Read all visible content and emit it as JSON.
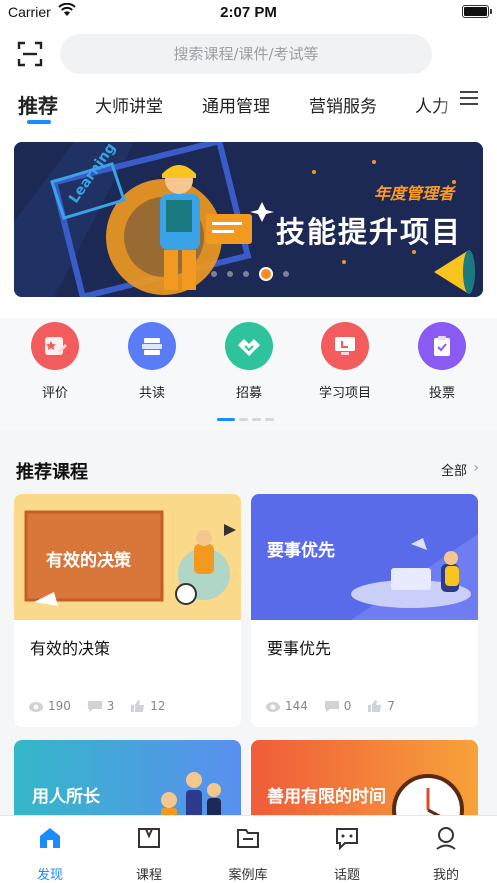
{
  "status": {
    "carrier": "Carrier",
    "time": "2:07 PM"
  },
  "search": {
    "placeholder": "搜索课程/课件/考试等"
  },
  "tabs": [
    {
      "label": "推荐"
    },
    {
      "label": "大师讲堂"
    },
    {
      "label": "通用管理"
    },
    {
      "label": "营销服务"
    },
    {
      "label": "人力"
    }
  ],
  "banner": {
    "title": "技能提升项目",
    "subtitle": "年度管理者",
    "pages": 5,
    "current_page": 4
  },
  "quick": [
    {
      "label": "评价",
      "icon": "rating-icon",
      "color": "#f25c5c"
    },
    {
      "label": "共读",
      "icon": "books-icon",
      "color": "#5b7cf7"
    },
    {
      "label": "招募",
      "icon": "handshake-icon",
      "color": "#2ec39a"
    },
    {
      "label": "学习项目",
      "icon": "monitor-icon",
      "color": "#f25c5c"
    },
    {
      "label": "投票",
      "icon": "clipboard-icon",
      "color": "#8a5bf2"
    }
  ],
  "recommended": {
    "title": "推荐课程",
    "all": "全部",
    "courses": [
      {
        "title": "有效的决策",
        "cover_text": "有效的决策",
        "views": "190",
        "comments": "3",
        "likes": "12"
      },
      {
        "title": "要事优先",
        "cover_text": "要事优先",
        "views": "144",
        "comments": "0",
        "likes": "7"
      },
      {
        "cover_text": "用人所长"
      },
      {
        "cover_text": "善用有限的时间"
      }
    ]
  },
  "nav": [
    {
      "label": "发现",
      "icon": "home-icon",
      "active": true
    },
    {
      "label": "课程",
      "icon": "book-icon",
      "active": false
    },
    {
      "label": "案例库",
      "icon": "folder-icon",
      "active": false
    },
    {
      "label": "话题",
      "icon": "chat-icon",
      "active": false
    },
    {
      "label": "我的",
      "icon": "profile-icon",
      "active": false
    }
  ],
  "colors": {
    "accent": "#1a8cff"
  }
}
